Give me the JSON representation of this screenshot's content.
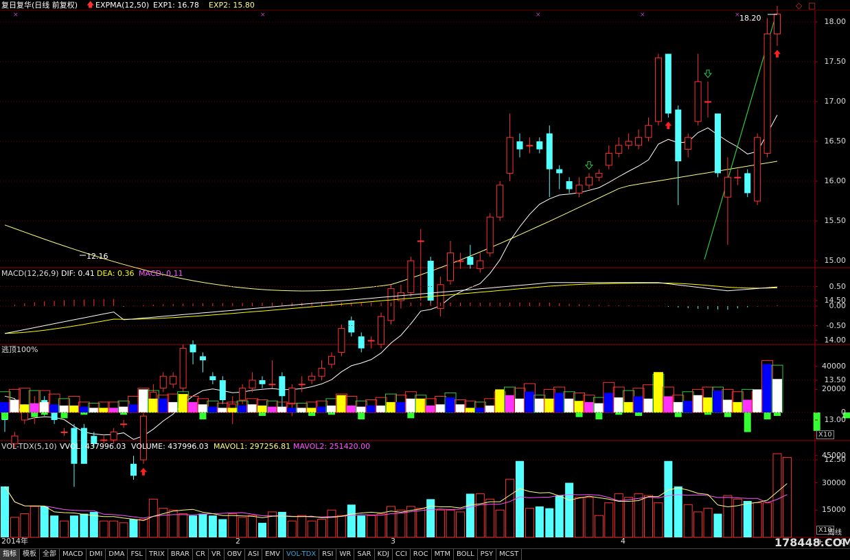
{
  "header": {
    "stock_title": "复日复华(日线 前复权)",
    "indicator_name": "EXPMA(12,50)",
    "exp1": "EXP1: 16.78",
    "exp2": "EXP2: 15.80"
  },
  "price_axis": [
    "18.00",
    "17.50",
    "17.00",
    "16.50",
    "16.00",
    "15.50",
    "15.00",
    "14.50",
    "14.00",
    "13.50",
    "13.00",
    "12.50"
  ],
  "annotations": {
    "high_label": "18.20",
    "low_label": "12.16"
  },
  "macd": {
    "title": "MACD(12,26,9)",
    "dif": "DIF: 0.41",
    "dea": "DEA: 0.36",
    "macd": "MACD: 0.11",
    "axis": [
      "0.50",
      "0.00",
      "-0.50"
    ]
  },
  "escape": {
    "title": "逃顶100%",
    "axis": [
      "40000",
      "20000",
      "0"
    ],
    "unit": "X10"
  },
  "vol": {
    "title": "VOL-TDX(5,10)",
    "vvol": "VVOL: 437996.03",
    "volume": "VOLUME: 437996.03",
    "mavol1": "MAVOL1: 297256.81",
    "mavol2": "MAVOL2: 251420.00",
    "axis": [
      "45000",
      "30000",
      "15000"
    ],
    "unit": "X10"
  },
  "date_axis": {
    "year": "2014年",
    "m2": "2",
    "m3": "3",
    "m4": "4"
  },
  "tabs": [
    "指标",
    "模板",
    "全部",
    "MACD",
    "DMI",
    "DMA",
    "FSL",
    "TRIX",
    "BRAR",
    "CR",
    "VR",
    "OBV",
    "ASI",
    "EMV",
    "VOL-TDX",
    "RSI",
    "WR",
    "SAR",
    "KDJ",
    "CCI",
    "ROC",
    "MTM",
    "BOLL",
    "PSY",
    "MCST"
  ],
  "controls": {
    "plus": "+",
    "minus": "-",
    "zero": "0",
    "week": "周线"
  },
  "watermark": "178448.COM",
  "colors": {
    "up": "#ff3232",
    "down": "#54ffff",
    "exp1": "#ffffff",
    "exp2": "#ffff80",
    "dif": "#ffffff",
    "dea": "#ffff00",
    "macd": "#ff55ff",
    "grid": "#800000",
    "axis": "#a00000",
    "trend": "#2ecc40"
  },
  "candles": [
    [
      13.1,
      13.0,
      13.15,
      12.85
    ],
    [
      12.7,
      12.8,
      12.85,
      12.65
    ],
    [
      13.0,
      13.15,
      13.2,
      12.95
    ],
    [
      13.1,
      13.2,
      13.3,
      12.95
    ],
    [
      13.25,
      13.1,
      13.3,
      13.05
    ],
    [
      13.1,
      13.0,
      13.15,
      12.95
    ],
    [
      12.85,
      12.85,
      12.9,
      12.8
    ],
    [
      12.9,
      12.45,
      12.95,
      12.16
    ],
    [
      12.9,
      12.45,
      12.95,
      12.45
    ],
    [
      12.8,
      12.7,
      12.85,
      12.65
    ],
    [
      12.75,
      12.75,
      12.8,
      12.7
    ],
    [
      12.75,
      12.85,
      12.9,
      12.7
    ],
    [
      12.95,
      12.95,
      13.0,
      12.9
    ],
    [
      12.45,
      12.3,
      12.55,
      12.25
    ],
    [
      12.5,
      13.05,
      13.1,
      12.45
    ],
    [
      13.2,
      13.35,
      13.45,
      13.1
    ],
    [
      13.4,
      13.55,
      13.6,
      13.35
    ],
    [
      13.45,
      13.55,
      13.6,
      13.4
    ],
    [
      13.4,
      13.9,
      13.95,
      13.35
    ],
    [
      13.95,
      13.85,
      14.0,
      13.7
    ],
    [
      13.8,
      13.75,
      13.85,
      13.6
    ],
    [
      13.55,
      13.5,
      13.6,
      13.45
    ],
    [
      13.5,
      13.25,
      13.55,
      13.2
    ],
    [
      13.1,
      13.2,
      13.3,
      12.95
    ],
    [
      13.25,
      13.4,
      13.45,
      13.2
    ],
    [
      13.4,
      13.5,
      13.6,
      13.35
    ],
    [
      13.5,
      13.45,
      13.55,
      13.4
    ],
    [
      13.45,
      13.45,
      13.75,
      13.4
    ],
    [
      13.55,
      13.3,
      13.6,
      13.1
    ],
    [
      13.2,
      13.4,
      13.45,
      13.05
    ],
    [
      13.45,
      13.45,
      13.55,
      13.35
    ],
    [
      13.5,
      13.55,
      13.6,
      13.45
    ],
    [
      13.55,
      13.65,
      13.75,
      13.5
    ],
    [
      13.7,
      13.8,
      13.85,
      13.65
    ],
    [
      13.85,
      14.15,
      14.2,
      13.8
    ],
    [
      14.25,
      14.1,
      14.3,
      14.05
    ],
    [
      14.05,
      13.9,
      14.1,
      13.85
    ],
    [
      14.0,
      14.0,
      14.05,
      13.9
    ],
    [
      13.95,
      14.3,
      14.35,
      13.9
    ],
    [
      14.25,
      14.65,
      14.7,
      14.2
    ],
    [
      14.5,
      14.6,
      14.7,
      14.4
    ],
    [
      14.6,
      15.0,
      15.05,
      14.55
    ],
    [
      15.25,
      15.25,
      15.4,
      14.5
    ],
    [
      15.0,
      14.5,
      15.05,
      14.45
    ],
    [
      14.4,
      14.7,
      14.8,
      14.3
    ],
    [
      14.75,
      15.1,
      15.25,
      14.7
    ],
    [
      15.0,
      15.0,
      15.1,
      14.9
    ],
    [
      15.05,
      14.95,
      15.2,
      14.9
    ],
    [
      14.9,
      15.0,
      15.1,
      14.85
    ],
    [
      15.1,
      15.55,
      15.6,
      15.05
    ],
    [
      15.55,
      15.95,
      16.0,
      15.5
    ],
    [
      16.1,
      16.55,
      16.85,
      16.0
    ],
    [
      16.5,
      16.4,
      16.6,
      16.3
    ],
    [
      16.45,
      16.45,
      16.55,
      16.35
    ],
    [
      16.5,
      16.4,
      16.55,
      16.35
    ],
    [
      16.6,
      16.15,
      16.7,
      15.8
    ],
    [
      16.15,
      16.1,
      16.2,
      15.9
    ],
    [
      16.0,
      15.9,
      16.05,
      15.85
    ],
    [
      15.85,
      15.95,
      16.05,
      15.8
    ],
    [
      15.95,
      16.05,
      16.1,
      15.9
    ],
    [
      16.05,
      16.1,
      16.15,
      16.0
    ],
    [
      16.2,
      16.35,
      16.45,
      16.15
    ],
    [
      16.35,
      16.45,
      16.55,
      16.3
    ],
    [
      16.45,
      16.5,
      16.6,
      16.4
    ],
    [
      16.45,
      16.55,
      16.65,
      16.4
    ],
    [
      16.55,
      16.7,
      16.8,
      16.5
    ],
    [
      16.75,
      17.55,
      17.6,
      16.7
    ],
    [
      17.6,
      16.85,
      17.6,
      16.8
    ],
    [
      16.9,
      16.25,
      16.95,
      15.7
    ],
    [
      16.4,
      16.55,
      16.6,
      16.3
    ],
    [
      16.75,
      17.25,
      17.6,
      16.7
    ],
    [
      17.0,
      17.0,
      17.25,
      16.8
    ],
    [
      16.85,
      16.1,
      16.85,
      16.05
    ],
    [
      15.8,
      16.05,
      16.3,
      15.2
    ],
    [
      16.05,
      16.05,
      16.15,
      15.95
    ],
    [
      16.1,
      15.85,
      16.15,
      15.8
    ],
    [
      15.75,
      16.55,
      16.6,
      15.7
    ],
    [
      16.35,
      17.85,
      18.05,
      16.3
    ],
    [
      17.85,
      18.1,
      18.2,
      17.7
    ]
  ],
  "escape_bars": [
    [
      18000,
      9000
    ],
    [
      20000,
      11000
    ],
    [
      21000,
      7000
    ],
    [
      19000,
      8000
    ],
    [
      19000,
      9000
    ],
    [
      16000,
      7000
    ],
    [
      12000,
      6000
    ],
    [
      14000,
      6000
    ],
    [
      9000,
      5000
    ],
    [
      8000,
      4000
    ],
    [
      9000,
      4000
    ],
    [
      9000,
      4000
    ],
    [
      10000,
      5000
    ],
    [
      14000,
      7000
    ],
    [
      21000,
      20000
    ],
    [
      19000,
      12000
    ],
    [
      15000,
      12000
    ],
    [
      16000,
      9000
    ],
    [
      18000,
      16000
    ],
    [
      14000,
      9000
    ],
    [
      12000,
      7000
    ],
    [
      10000,
      5000
    ],
    [
      8000,
      4000
    ],
    [
      9000,
      4000
    ],
    [
      10000,
      6000
    ],
    [
      12000,
      7000
    ],
    [
      11000,
      6000
    ],
    [
      10000,
      5000
    ],
    [
      9000,
      5000
    ],
    [
      8000,
      4000
    ],
    [
      8000,
      4000
    ],
    [
      9000,
      4000
    ],
    [
      10000,
      5000
    ],
    [
      12000,
      6000
    ],
    [
      16000,
      15000
    ],
    [
      14000,
      6000
    ],
    [
      10000,
      5000
    ],
    [
      11000,
      6000
    ],
    [
      13000,
      6000
    ],
    [
      16000,
      9000
    ],
    [
      15000,
      9000
    ],
    [
      18000,
      12000
    ],
    [
      15000,
      12000
    ],
    [
      12000,
      6000
    ],
    [
      14000,
      7000
    ],
    [
      17000,
      13000
    ],
    [
      11000,
      7000
    ],
    [
      10000,
      4000
    ],
    [
      9000,
      4000
    ],
    [
      12000,
      6000
    ],
    [
      18000,
      20000
    ],
    [
      22000,
      15000
    ],
    [
      21000,
      12000
    ],
    [
      25000,
      18000
    ],
    [
      15000,
      12000
    ],
    [
      20000,
      12000
    ],
    [
      22000,
      17000
    ],
    [
      18000,
      12000
    ],
    [
      17000,
      10000
    ],
    [
      15000,
      9000
    ],
    [
      13000,
      8000
    ],
    [
      26000,
      17000
    ],
    [
      22000,
      13000
    ],
    [
      19000,
      9000
    ],
    [
      21000,
      14000
    ],
    [
      24000,
      12000
    ],
    [
      33000,
      35000
    ],
    [
      22000,
      14000
    ],
    [
      15000,
      9000
    ],
    [
      18000,
      10000
    ],
    [
      20000,
      15000
    ],
    [
      22000,
      13000
    ],
    [
      22000,
      19000
    ],
    [
      20000,
      11000
    ],
    [
      18000,
      9000
    ],
    [
      20000,
      11000
    ],
    [
      18000,
      20000
    ],
    [
      45000,
      42000
    ],
    [
      41000,
      29000
    ]
  ],
  "escape_neg": [
    [
      0,
      -6000
    ],
    [
      3,
      -4000
    ],
    [
      4,
      -2000
    ],
    [
      6,
      -5000
    ],
    [
      8,
      -2000
    ],
    [
      12,
      -2000
    ],
    [
      20,
      -6000
    ],
    [
      26,
      -3000
    ],
    [
      31,
      -3000
    ],
    [
      33,
      -2000
    ],
    [
      36,
      -6000
    ],
    [
      41,
      -5000
    ],
    [
      58,
      -4000
    ],
    [
      60,
      -6000
    ],
    [
      62,
      -2000
    ],
    [
      64,
      -3000
    ],
    [
      68,
      -4000
    ],
    [
      71,
      -2000
    ],
    [
      73,
      -4000
    ],
    [
      75,
      -17000
    ],
    [
      77,
      -6000
    ],
    [
      78,
      -3000
    ],
    [
      82,
      -16000
    ],
    [
      85,
      -5000
    ]
  ],
  "vol_bars": [
    28000,
    11000,
    13000,
    17000,
    17000,
    12000,
    9000,
    12000,
    13000,
    14000,
    9000,
    9000,
    8000,
    10000,
    10000,
    21000,
    16000,
    15000,
    13000,
    12000,
    13000,
    12000,
    10000,
    13000,
    11000,
    12000,
    8000,
    14000,
    14000,
    9000,
    12000,
    9000,
    10000,
    15000,
    12000,
    18000,
    12000,
    12000,
    13000,
    17000,
    15000,
    17000,
    16000,
    21000,
    15000,
    15000,
    14000,
    24000,
    24000,
    21000,
    15000,
    32000,
    42000,
    16000,
    17000,
    16000,
    23000,
    30000,
    22000,
    22000,
    12000,
    19000,
    24000,
    22000,
    24000,
    23000,
    19000,
    42000,
    28000,
    18000,
    14000,
    16000,
    13000,
    23000,
    21000,
    20000,
    19000,
    19000,
    46000,
    44000
  ]
}
